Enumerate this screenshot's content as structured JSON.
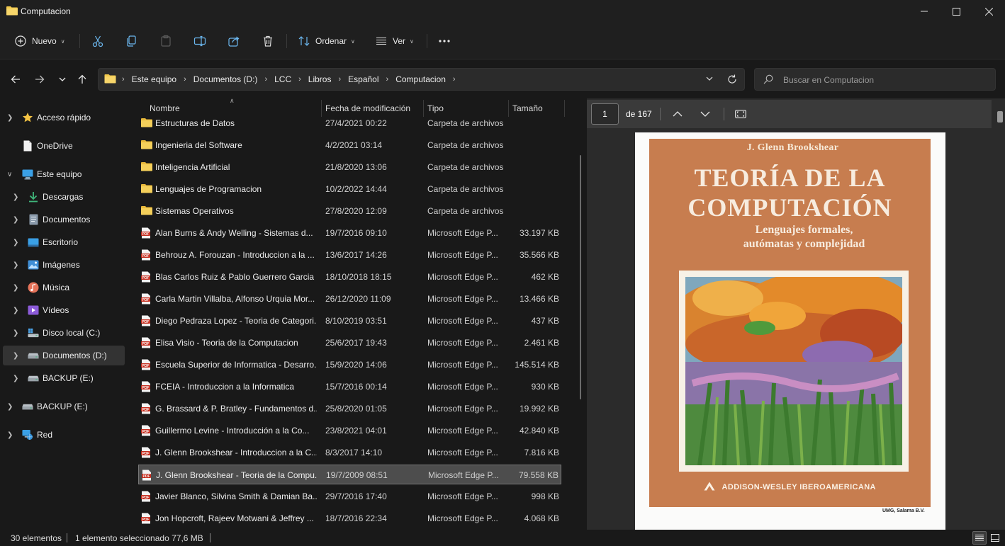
{
  "window": {
    "title": "Computacion"
  },
  "toolbar": {
    "new_label": "Nuevo",
    "sort_label": "Ordenar",
    "view_label": "Ver",
    "more_label": "..."
  },
  "address": {
    "crumbs": [
      "Este equipo",
      "Documentos (D:)",
      "LCC",
      "Libros",
      "Español",
      "Computacion"
    ]
  },
  "search": {
    "placeholder": "Buscar en Computacion"
  },
  "nav": {
    "items": [
      {
        "label": "Acceso rápido",
        "icon": "star-icon"
      },
      {
        "label": "OneDrive",
        "icon": "file-icon"
      },
      {
        "label": "Este equipo",
        "icon": "computer-icon"
      },
      {
        "label": "Descargas",
        "icon": "download-icon"
      },
      {
        "label": "Documentos",
        "icon": "documents-icon"
      },
      {
        "label": "Escritorio",
        "icon": "desktop-icon"
      },
      {
        "label": "Imágenes",
        "icon": "pictures-icon"
      },
      {
        "label": "Música",
        "icon": "music-icon"
      },
      {
        "label": "Vídeos",
        "icon": "videos-icon"
      },
      {
        "label": "Disco local (C:)",
        "icon": "windows-drive-icon"
      },
      {
        "label": "Documentos (D:)",
        "icon": "drive-icon"
      },
      {
        "label": "BACKUP (E:)",
        "icon": "drive-icon"
      },
      {
        "label": "BACKUP (E:)",
        "icon": "drive-icon"
      },
      {
        "label": "Red",
        "icon": "network-icon"
      }
    ]
  },
  "columns": {
    "name": "Nombre",
    "date": "Fecha de modificación",
    "type": "Tipo",
    "size": "Tamaño"
  },
  "files": [
    {
      "name": "Estructuras de Datos",
      "date": "27/4/2021 00:22",
      "type": "Carpeta de archivos",
      "size": "",
      "kind": "folder"
    },
    {
      "name": "Ingenieria del Software",
      "date": "4/2/2021 03:14",
      "type": "Carpeta de archivos",
      "size": "",
      "kind": "folder"
    },
    {
      "name": "Inteligencia Artificial",
      "date": "21/8/2020 13:06",
      "type": "Carpeta de archivos",
      "size": "",
      "kind": "folder"
    },
    {
      "name": "Lenguajes de Programacion",
      "date": "10/2/2022 14:44",
      "type": "Carpeta de archivos",
      "size": "",
      "kind": "folder"
    },
    {
      "name": "Sistemas Operativos",
      "date": "27/8/2020 12:09",
      "type": "Carpeta de archivos",
      "size": "",
      "kind": "folder"
    },
    {
      "name": "Alan Burns & Andy Welling  - Sistemas d...",
      "date": "19/7/2016 09:10",
      "type": "Microsoft Edge P...",
      "size": "33.197 KB",
      "kind": "pdf"
    },
    {
      "name": "Behrouz A. Forouzan - Introduccion a la ...",
      "date": "13/6/2017 14:26",
      "type": "Microsoft Edge P...",
      "size": "35.566 KB",
      "kind": "pdf"
    },
    {
      "name": "Blas Carlos Ruiz & Pablo Guerrero Garcia ...",
      "date": "18/10/2018 18:15",
      "type": "Microsoft Edge P...",
      "size": "462 KB",
      "kind": "pdf"
    },
    {
      "name": "Carla Martin Villalba, Alfonso Urquia Mor...",
      "date": "26/12/2020 11:09",
      "type": "Microsoft Edge P...",
      "size": "13.466 KB",
      "kind": "pdf"
    },
    {
      "name": "Diego Pedraza Lopez - Teoria de Categori...",
      "date": "8/10/2019 03:51",
      "type": "Microsoft Edge P...",
      "size": "437 KB",
      "kind": "pdf"
    },
    {
      "name": "Elisa Visio - Teoria de la Computacion",
      "date": "25/6/2017 19:43",
      "type": "Microsoft Edge P...",
      "size": "2.461 KB",
      "kind": "pdf"
    },
    {
      "name": "Escuela Superior de Informatica - Desarro...",
      "date": "15/9/2020 14:06",
      "type": "Microsoft Edge P...",
      "size": "145.514 KB",
      "kind": "pdf"
    },
    {
      "name": "FCEIA - Introduccion a la Informatica",
      "date": "15/7/2016 00:14",
      "type": "Microsoft Edge P...",
      "size": "930 KB",
      "kind": "pdf"
    },
    {
      "name": "G. Brassard & P. Bratley - Fundamentos d...",
      "date": "25/8/2020 01:05",
      "type": "Microsoft Edge P...",
      "size": "19.992 KB",
      "kind": "pdf"
    },
    {
      "name": "Guillermo Levine - Introducción a la Co...",
      "date": "23/8/2021 04:01",
      "type": "Microsoft Edge P...",
      "size": "42.840 KB",
      "kind": "pdf"
    },
    {
      "name": "J. Glenn Brookshear - Introduccion a la C...",
      "date": "8/3/2017 14:10",
      "type": "Microsoft Edge P...",
      "size": "7.816 KB",
      "kind": "pdf"
    },
    {
      "name": "J. Glenn Brookshear - Teoria de la Compu...",
      "date": "19/7/2009 08:51",
      "type": "Microsoft Edge P...",
      "size": "79.558 KB",
      "kind": "pdf",
      "selected": true
    },
    {
      "name": "Javier Blanco, Silvina Smith & Damian Ba...",
      "date": "29/7/2016 17:40",
      "type": "Microsoft Edge P...",
      "size": "998 KB",
      "kind": "pdf"
    },
    {
      "name": "Jon Hopcroft, Rajeev Motwani & Jeffrey ...",
      "date": "18/7/2016 22:34",
      "type": "Microsoft Edge P...",
      "size": "4.068 KB",
      "kind": "pdf"
    }
  ],
  "preview": {
    "page_current": "1",
    "page_total_label": "de 167",
    "cover": {
      "author": "J. Glenn Brookshear",
      "title_line1": "TEORÍA DE LA",
      "title_line2": "COMPUTACIÓN",
      "subtitle_line1": "Lenguajes formales,",
      "subtitle_line2": "autómatas y complejidad",
      "publisher": "ADDISON-WESLEY IBEROAMERICANA",
      "credit": "UMG, Salama B.V."
    }
  },
  "status": {
    "count": "30 elementos",
    "selection": "1 elemento seleccionado  77,6 MB"
  },
  "colors": {
    "background": "#191919",
    "selection": "#4d4d4d",
    "folder": "#f2c94c",
    "pdf": "#c42b1c",
    "cover": "#c77d4f"
  }
}
